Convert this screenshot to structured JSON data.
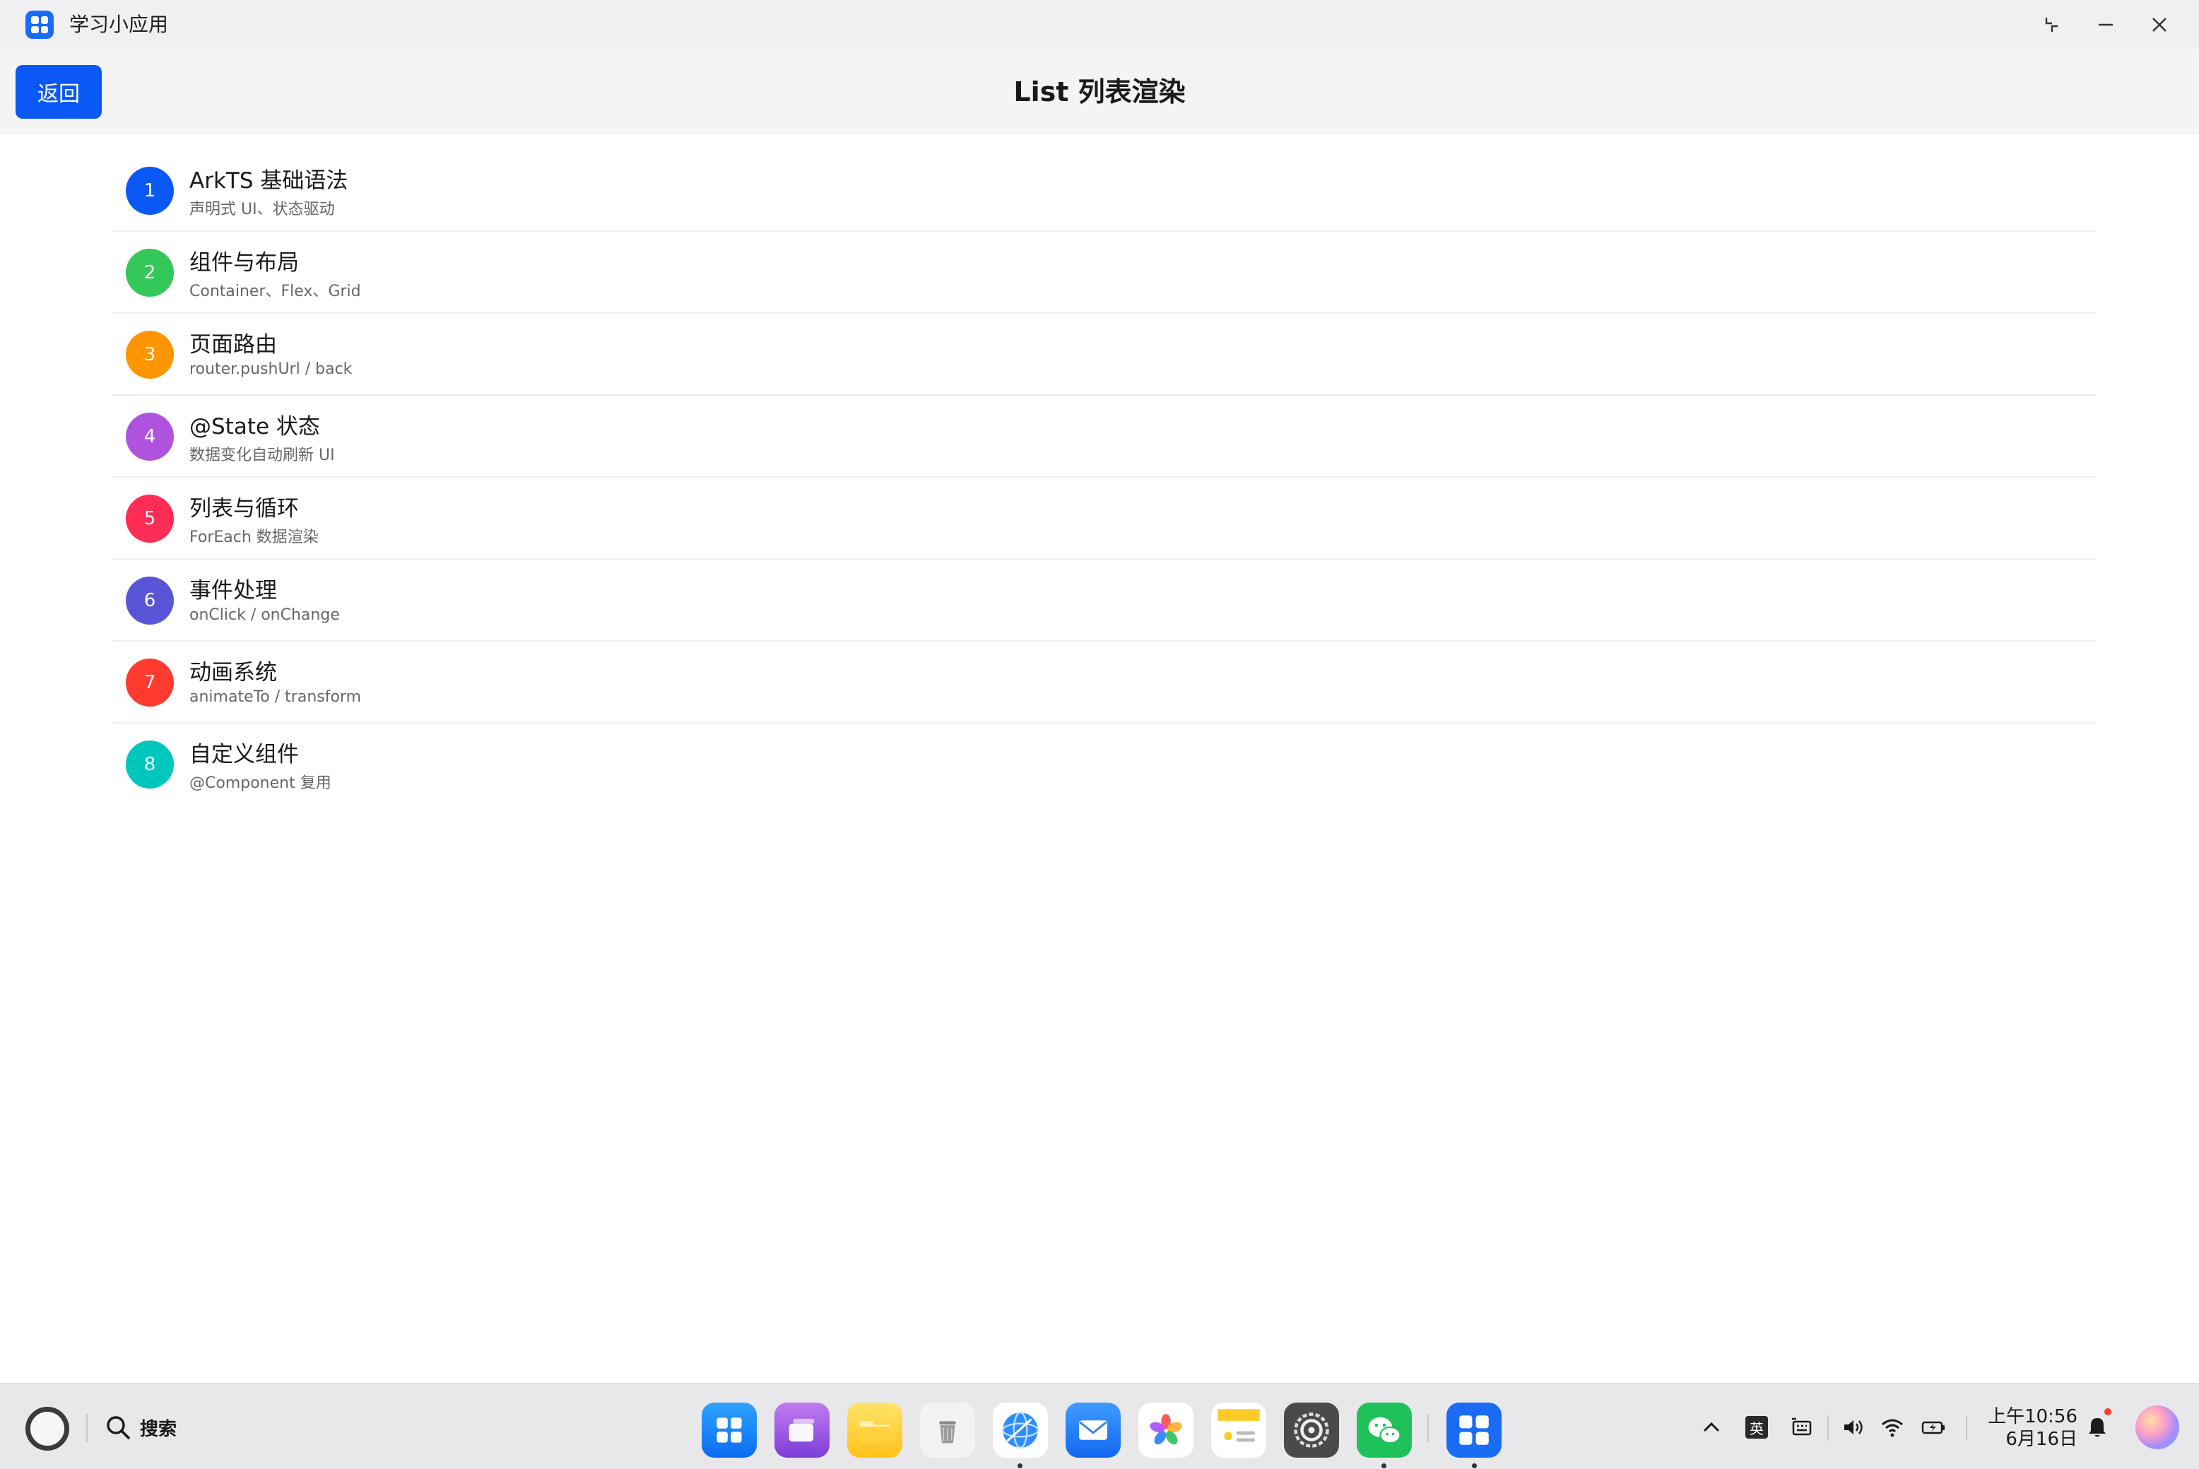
{
  "window": {
    "title": "学习小应用"
  },
  "header": {
    "back_label": "返回",
    "title": "List 列表渲染"
  },
  "list": {
    "items": [
      {
        "index": "1",
        "title": "ArkTS 基础语法",
        "subtitle": "声明式 UI、状态驱动",
        "color": "#0a59f7"
      },
      {
        "index": "2",
        "title": "组件与布局",
        "subtitle": "Container、Flex、Grid",
        "color": "#34c759"
      },
      {
        "index": "3",
        "title": "页面路由",
        "subtitle": "router.pushUrl / back",
        "color": "#ff9500"
      },
      {
        "index": "4",
        "title": "@State 状态",
        "subtitle": "数据变化自动刷新 UI",
        "color": "#af52de"
      },
      {
        "index": "5",
        "title": "列表与循环",
        "subtitle": "ForEach 数据渲染",
        "color": "#ff2d55"
      },
      {
        "index": "6",
        "title": "事件处理",
        "subtitle": "onClick / onChange",
        "color": "#5856d6"
      },
      {
        "index": "7",
        "title": "动画系统",
        "subtitle": "animateTo / transform",
        "color": "#ff3b30"
      },
      {
        "index": "8",
        "title": "自定义组件",
        "subtitle": "@Component 复用",
        "color": "#00c7be"
      }
    ]
  },
  "taskbar": {
    "search_label": "搜索",
    "ime_label": "英",
    "time": "上午10:56",
    "date": "6月16日",
    "dock": [
      {
        "name": "app-center-icon",
        "running": false
      },
      {
        "name": "multitask-icon",
        "running": false
      },
      {
        "name": "files-icon",
        "running": false
      },
      {
        "name": "trash-icon",
        "running": false
      },
      {
        "name": "browser-icon",
        "running": true
      },
      {
        "name": "mail-icon",
        "running": false
      },
      {
        "name": "gallery-icon",
        "running": false
      },
      {
        "name": "notes-icon",
        "running": false
      },
      {
        "name": "settings-icon",
        "running": false
      },
      {
        "name": "wechat-icon",
        "running": true
      },
      {
        "name": "study-app-icon",
        "running": true
      }
    ]
  }
}
